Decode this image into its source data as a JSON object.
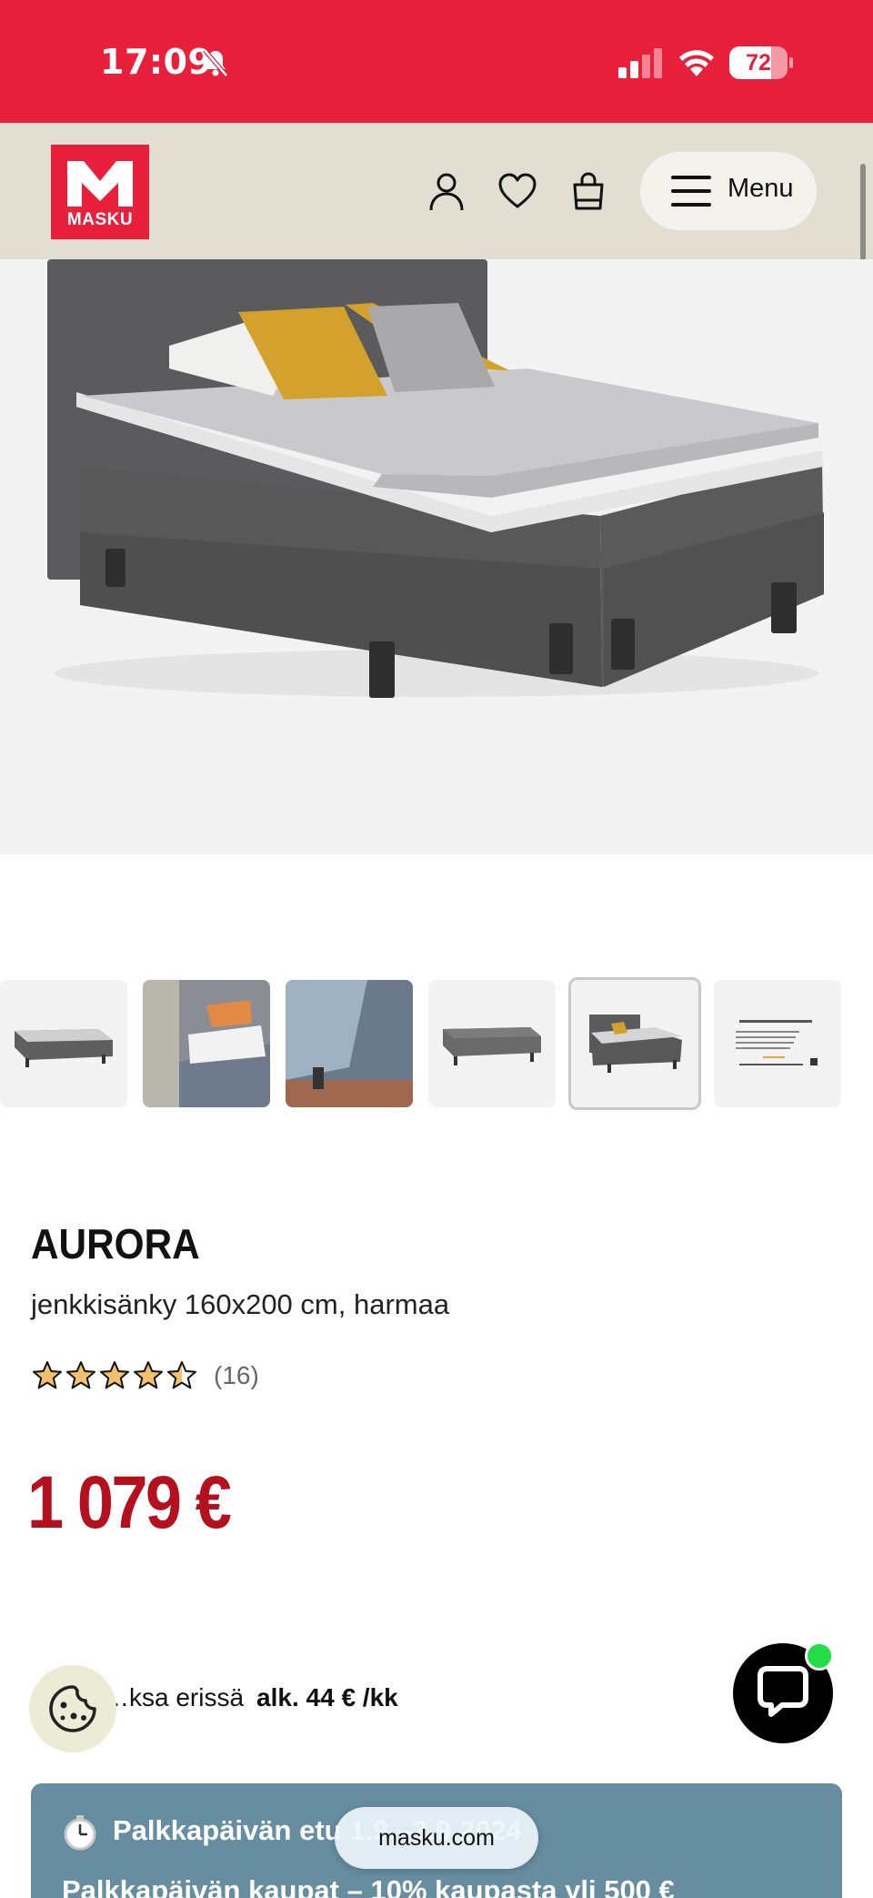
{
  "status_bar": {
    "time": "17:09",
    "battery_percent": "72",
    "battery_level": 0.72,
    "icons": [
      "bell-slash-icon",
      "cellular-signal-icon",
      "wifi-icon",
      "battery-icon"
    ]
  },
  "header": {
    "logo_text": "MASKU",
    "icons": [
      "account-icon",
      "heart-icon",
      "shopping-bag-icon"
    ],
    "menu_label": "Menu"
  },
  "gallery": {
    "thumbnail_count": 6,
    "active_index": 4,
    "thumbnails": [
      "bed-low-view",
      "bed-detail-pillows",
      "bed-leg-closeup",
      "bed-base-view",
      "bed-with-headboard",
      "review-summary-card"
    ]
  },
  "product": {
    "brand": "AURORA",
    "description": "jenkkisänky 160x200 cm, harmaa",
    "rating": 4.5,
    "rating_max": 5,
    "review_count": "(16)",
    "price": "1 079 €"
  },
  "installment": {
    "prefix": "…ksa erissä",
    "amount": "alk. 44 € /kk"
  },
  "promo": {
    "title": "Palkkapäivän etu 1.9.–2.9.2024",
    "body": "Palkkapäivän kaupat – 10% kaupasta yli 500 €"
  },
  "browser": {
    "url": "masku.com"
  },
  "colors": {
    "brand_red": "#e8203c",
    "header_beige": "#e3ded2",
    "price_red": "#b5101d",
    "promo_blue": "#678ea0",
    "star_fill": "#f3c06b"
  }
}
